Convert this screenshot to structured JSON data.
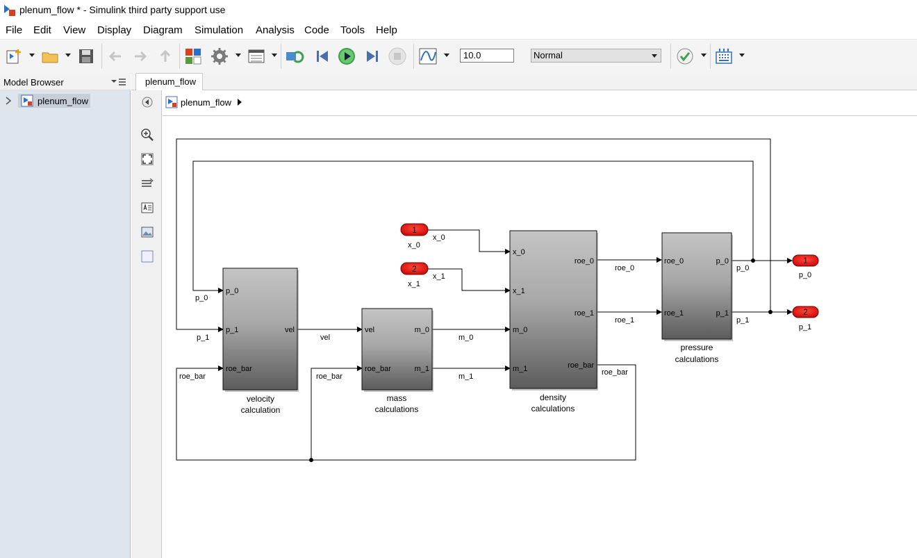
{
  "window": {
    "title": "plenum_flow * - Simulink third party support use"
  },
  "menu": [
    "File",
    "Edit",
    "View",
    "Display",
    "Diagram",
    "Simulation",
    "Analysis",
    "Code",
    "Tools",
    "Help"
  ],
  "toolbar": {
    "stop_time": "10.0",
    "sim_mode": "Normal"
  },
  "model_browser": {
    "header": "Model Browser",
    "item": "plenum_flow"
  },
  "tab": {
    "label": "plenum_flow"
  },
  "breadcrumb": {
    "label": "plenum_flow"
  },
  "diagram": {
    "inports": [
      {
        "number": "1",
        "name": "x_0"
      },
      {
        "number": "2",
        "name": "x_1"
      }
    ],
    "outports": [
      {
        "number": "1",
        "name": "p_0"
      },
      {
        "number": "2",
        "name": "p_1"
      }
    ],
    "blocks": {
      "velocity": {
        "name_line1": "velocity",
        "name_line2": "calculation",
        "in_ports": [
          "p_0",
          "p_1",
          "roe_bar"
        ],
        "out_ports": [
          "vel"
        ]
      },
      "mass": {
        "name_line1": "mass",
        "name_line2": "calculations",
        "in_ports": [
          "vel",
          "roe_bar"
        ],
        "out_ports": [
          "m_0",
          "m_1"
        ]
      },
      "density": {
        "name_line1": "density",
        "name_line2": "calculations",
        "in_ports": [
          "x_0",
          "x_1",
          "m_0",
          "m_1"
        ],
        "out_ports": [
          "roe_0",
          "roe_1",
          "roe_bar"
        ]
      },
      "pressure": {
        "name_line1": "pressure",
        "name_line2": "calculations",
        "in_ports": [
          "roe_0",
          "roe_1"
        ],
        "out_ports": [
          "p_0",
          "p_1"
        ]
      }
    },
    "signals": {
      "x_0": "x_0",
      "x_1": "x_1",
      "vel": "vel",
      "m_0": "m_0",
      "m_1": "m_1",
      "roe_0": "roe_0",
      "roe_1": "roe_1",
      "p_0_out": "p_0",
      "p_1_out": "p_1",
      "p_0_fb": "p_0",
      "p_1_fb": "p_1",
      "roe_bar_vel": "roe_bar",
      "roe_bar_mass": "roe_bar",
      "roe_bar_out": "roe_bar"
    }
  }
}
